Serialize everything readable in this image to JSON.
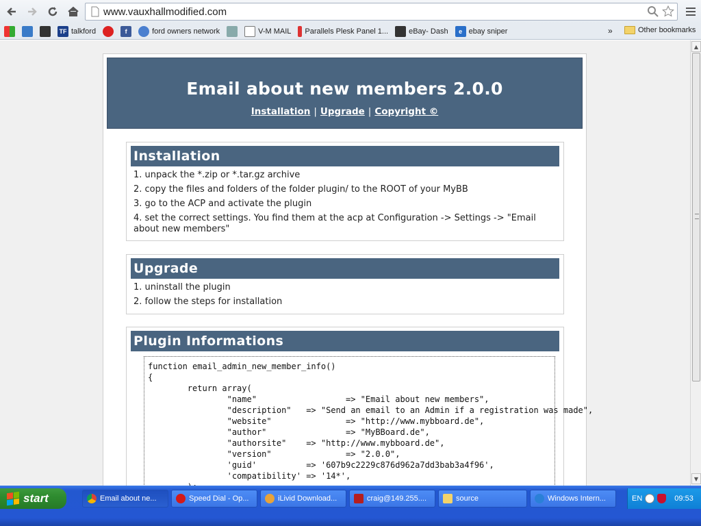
{
  "browser": {
    "url": "www.vauxhallmodified.com",
    "bookmarks": [
      {
        "label": "",
        "icon": "apps-icon"
      },
      {
        "label": "",
        "icon": "photo-icon"
      },
      {
        "label": "",
        "icon": "bag-icon"
      },
      {
        "label": "talkford",
        "icon": "tf-icon"
      },
      {
        "label": "",
        "icon": "vauxhall-icon"
      },
      {
        "label": "",
        "icon": "facebook-icon"
      },
      {
        "label": "ford owners network",
        "icon": "globe-icon"
      },
      {
        "label": "",
        "icon": "flag-icon"
      },
      {
        "label": "V-M MAIL",
        "icon": "mail-icon"
      },
      {
        "label": "Parallels Plesk Panel 1...",
        "icon": "plesk-icon"
      },
      {
        "label": "eBay- Dash",
        "icon": "ebay-icon"
      },
      {
        "label": "ebay sniper",
        "icon": "e-icon"
      }
    ],
    "chevron": "»",
    "other_bookmarks": "Other bookmarks"
  },
  "page": {
    "title": "Email about new members 2.0.0",
    "links": [
      "Installation",
      "Upgrade",
      "Copyright ©"
    ],
    "link_sep": "|",
    "installation": {
      "heading": "Installation",
      "items": [
        "1. unpack the *.zip or *.tar.gz archive",
        "2. copy the files and folders of the folder plugin/ to the ROOT of your MyBB",
        "3. go to the ACP and activate the plugin",
        "4. set the correct settings. You find them at the acp at Configuration -> Settings -> \"Email about new members\""
      ]
    },
    "upgrade": {
      "heading": "Upgrade",
      "items": [
        "1. uninstall the plugin",
        "2. follow the steps for installation"
      ]
    },
    "plugin_info": {
      "heading": "Plugin Informations",
      "code": "function email_admin_new_member_info()\n{\n        return array(\n                \"name\"                  => \"Email about new members\",\n                \"description\"   => \"Send an email to an Admin if a registration was made\",\n                \"website\"               => \"http://www.mybboard.de\",\n                \"author\"                => \"MyBBoard.de\",\n                \"authorsite\"    => \"http://www.mybboard.de\",\n                \"version\"               => \"2.0.0\",\n                'guid'          => '607b9c2229c876d962a7dd3bab3a4f96',\n                'compatibility' => '14*',\n        );"
    }
  },
  "taskbar": {
    "start": "start",
    "tasks": [
      "Email about ne...",
      "Speed Dial - Op...",
      "iLivid Download...",
      "craig@149.255....",
      "source",
      "Windows Intern..."
    ],
    "lang": "EN",
    "clock": "09:53"
  }
}
